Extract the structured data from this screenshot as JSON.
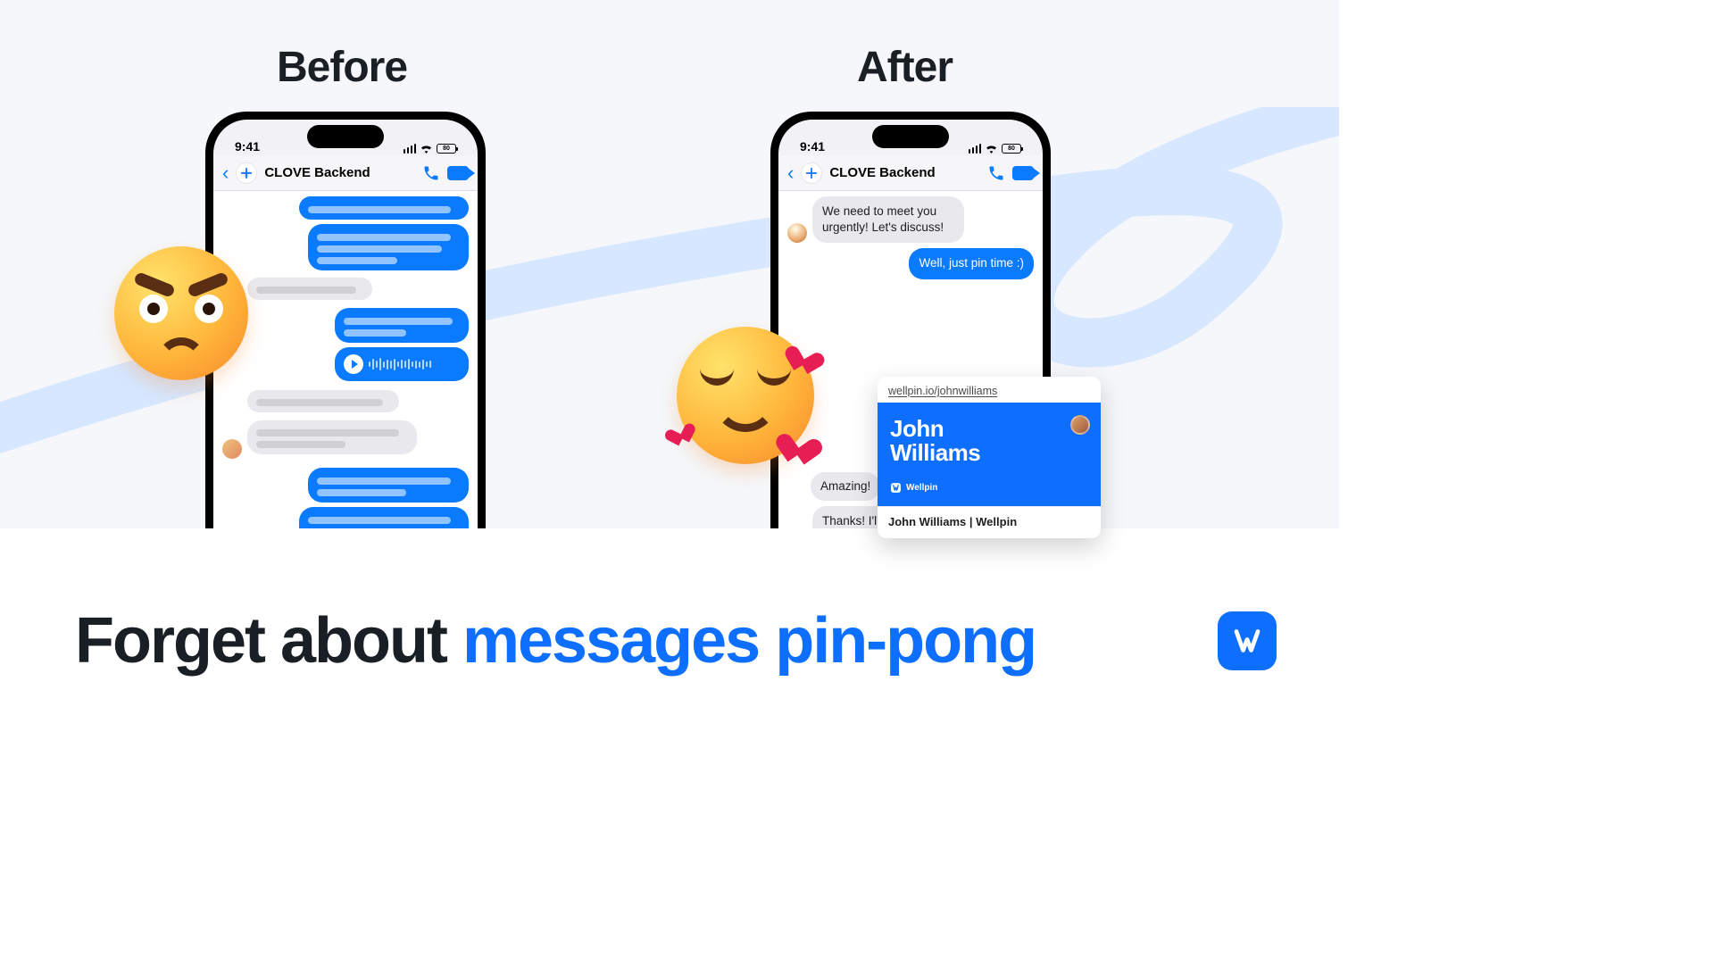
{
  "labels": {
    "before": "Before",
    "after": "After"
  },
  "status": {
    "time": "9:41",
    "battery": "80"
  },
  "chat": {
    "name": "CLOVE Backend"
  },
  "after_chat": {
    "msg1": "We need to meet you urgently! Let's discuss!",
    "reply1": "Well, just pin time :)",
    "msg2": "Amazing!",
    "msg3": "Thanks! I'll get in touch with you!"
  },
  "card": {
    "url": "wellpin.io/johnwilliams",
    "first": "John",
    "last": "Williams",
    "brand": "Wellpin",
    "footer": "John Williams | Wellpin"
  },
  "headline": {
    "plain": "Forget about ",
    "accent": "messages pin-pong"
  }
}
